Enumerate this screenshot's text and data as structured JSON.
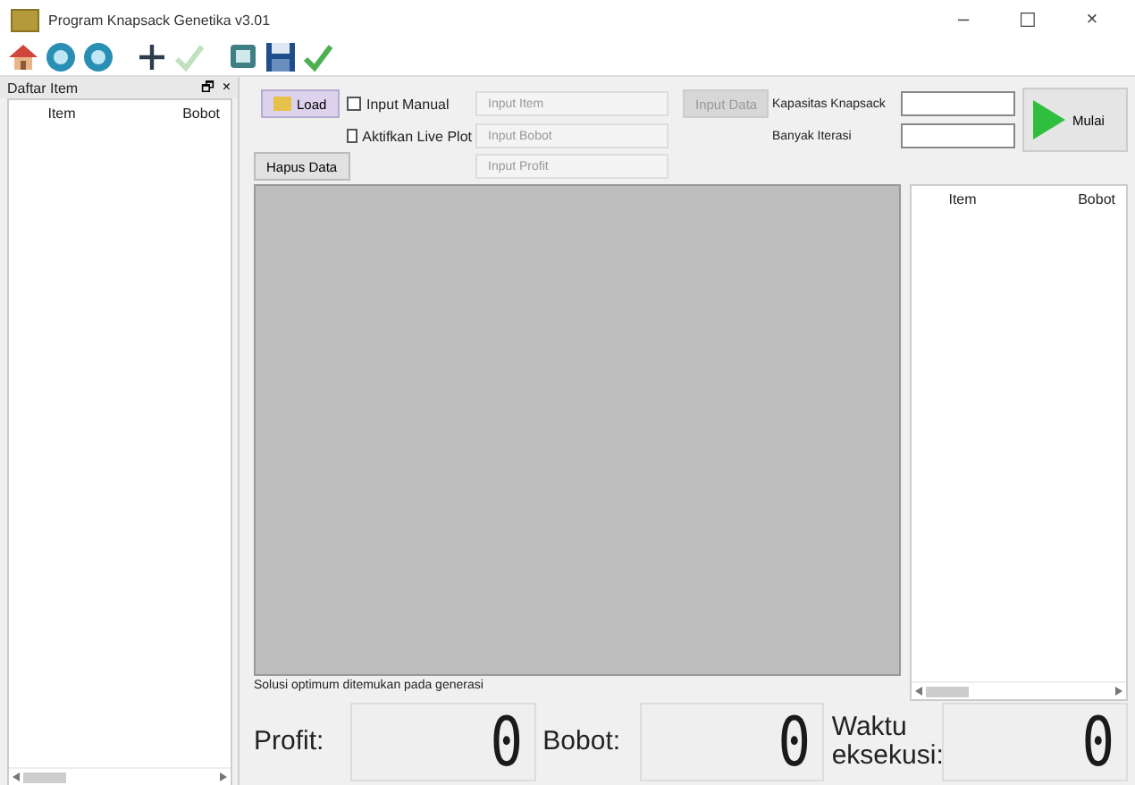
{
  "window": {
    "title": "Program Knapsack Genetika v3.01",
    "controls": [
      "–",
      "☐",
      "×"
    ]
  },
  "toolbar": [
    {
      "kind": "home",
      "disabled": false
    },
    {
      "kind": "back",
      "disabled": false
    },
    {
      "kind": "forward",
      "disabled": false
    },
    {
      "kind": "add",
      "disabled": false
    },
    {
      "kind": "check",
      "disabled": true
    },
    {
      "kind": "screen",
      "disabled": false
    },
    {
      "kind": "save",
      "disabled": false
    },
    {
      "kind": "check",
      "disabled": false
    }
  ],
  "dock": {
    "title": "Daftar Item",
    "buttons": [
      "🗗",
      "×"
    ],
    "columns": [
      "Item",
      "Bobot"
    ]
  },
  "controls": {
    "load_button": "Load",
    "input_manual": {
      "label": "Input Manual",
      "checked": false
    },
    "live_plot": {
      "label": "Aktifkan Live Plot",
      "checked": false
    },
    "clear_button": "Hapus Data",
    "fields": [
      {
        "placeholder": "Input Item",
        "disabled": true
      },
      {
        "placeholder": "Input Bobot",
        "disabled": true
      },
      {
        "placeholder": "Input Profit",
        "disabled": true
      }
    ],
    "input_button": {
      "label": "Input Data",
      "disabled": true
    },
    "capacity_label": "Kapasitas Knapsack",
    "iterations_label": "Banyak Iterasi",
    "start_button": "Mulai"
  },
  "result_list": {
    "columns": [
      "Item",
      "Bobot"
    ]
  },
  "status": "Solusi optimum ditemukan pada generasi",
  "readouts": [
    {
      "label": "Profit:",
      "value": "0"
    },
    {
      "label": "Bobot:",
      "value": "0"
    },
    {
      "label": "Waktu eksekusi:",
      "value": "0"
    }
  ]
}
